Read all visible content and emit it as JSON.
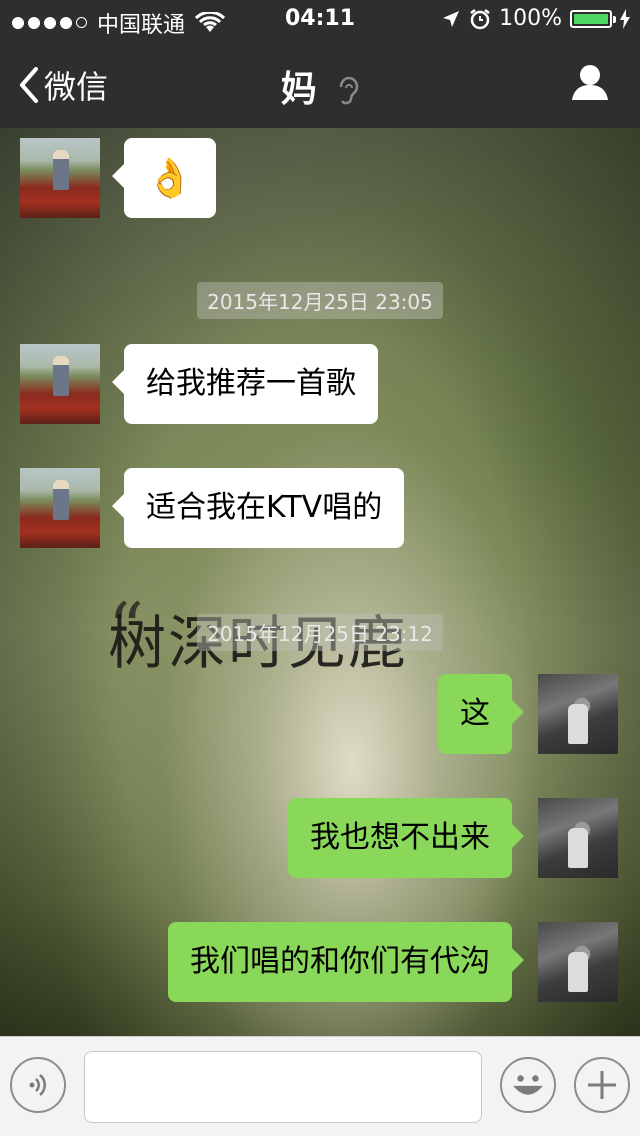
{
  "status_bar": {
    "carrier": "中国联通",
    "time": "04:11",
    "battery": "100%",
    "signal_dots": 5,
    "signal_filled": 4
  },
  "nav": {
    "back_label": "微信",
    "title": "妈"
  },
  "background": {
    "title_text": "树深时见鹿",
    "quote_mark": "“"
  },
  "messages": [
    {
      "from": "mom",
      "type": "emoji",
      "content": "👌"
    },
    {
      "type": "timestamp",
      "text": "2015年12月25日 23:05"
    },
    {
      "from": "mom",
      "type": "text",
      "text": "给我推荐一首歌"
    },
    {
      "from": "mom",
      "type": "text",
      "text": "适合我在KTV唱的"
    },
    {
      "type": "timestamp",
      "text": "2015年12月25日 23:12"
    },
    {
      "from": "me",
      "type": "text",
      "text": "这"
    },
    {
      "from": "me",
      "type": "text",
      "text": "我也想不出来"
    },
    {
      "from": "me",
      "type": "text",
      "text": "我们唱的和你们有代沟"
    }
  ],
  "input": {
    "placeholder": ""
  },
  "colors": {
    "bar": "#2e2e2e",
    "bubble_out": "#8ad85a",
    "bubble_in": "#ffffff",
    "battery_fill": "#4cd964"
  }
}
